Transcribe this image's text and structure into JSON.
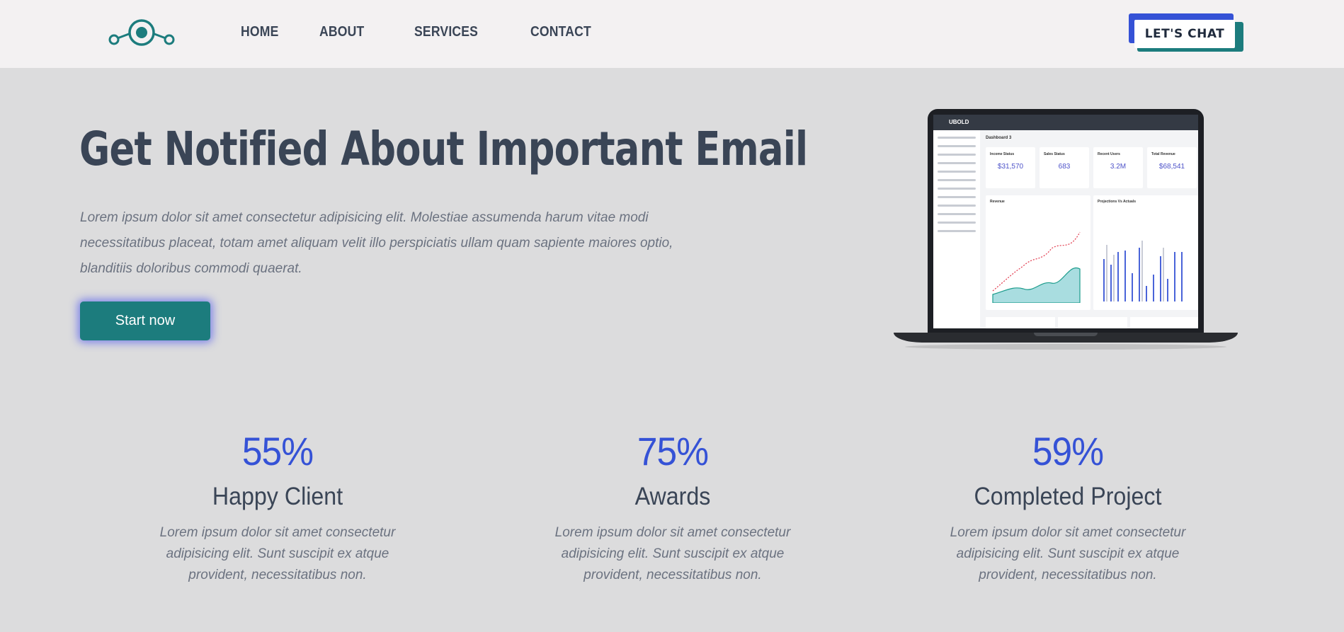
{
  "header": {
    "logo_icon": "dot-link-icon",
    "nav": [
      "HOME",
      "ABOUT",
      "SERVICES",
      "CONTACT"
    ],
    "chat_label": "LET'S CHAT"
  },
  "hero": {
    "title": "Get Notified About Important Email",
    "text": "Lorem ipsum dolor sit amet consectetur adipisicing elit. Molestiae assumenda harum vitae modi necessitatibus placeat, totam amet aliquam velit illo perspiciatis ullam quam sapiente maiores optio, blanditiis doloribus commodi quaerat.",
    "cta_label": "Start now"
  },
  "dashboard": {
    "brand": "UBOLD",
    "title": "Dashboard 3",
    "cards": [
      {
        "label": "Income Status",
        "value": "$31,570"
      },
      {
        "label": "Sales Status",
        "value": "683"
      },
      {
        "label": "Recent Users",
        "value": "3.2M"
      },
      {
        "label": "Total Revenue",
        "value": "$68,541"
      }
    ],
    "panels": [
      "Revenue",
      "Projections Vs Actuals"
    ]
  },
  "stats": [
    {
      "value": "55%",
      "label": "Happy Client",
      "text": "Lorem ipsum dolor sit amet consectetur adipisicing elit. Sunt suscipit ex atque provident, necessitatibus non."
    },
    {
      "value": "75%",
      "label": "Awards",
      "text": "Lorem ipsum dolor sit amet consectetur adipisicing elit. Sunt suscipit ex atque provident, necessitatibus non."
    },
    {
      "value": "59%",
      "label": "Completed Project",
      "text": "Lorem ipsum dolor sit amet consectetur adipisicing elit. Sunt suscipit ex atque provident, necessitatibus non."
    }
  ],
  "colors": {
    "accent_teal": "#1c7c7d",
    "accent_blue": "#3552d6",
    "text_dark": "#3a4556",
    "background": "#dcdcdd",
    "header_bg": "#f3f1f2"
  }
}
